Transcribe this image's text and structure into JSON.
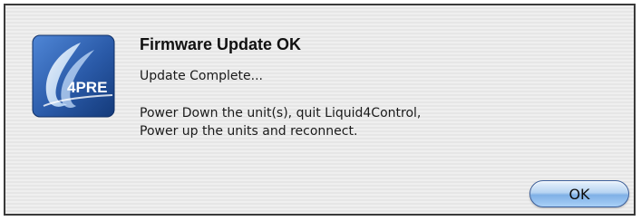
{
  "dialog": {
    "title": "Firmware Update OK",
    "subtitle": "Update Complete...",
    "message_lines": [
      "Power Down the unit(s), quit Liquid4Control,",
      "Power up the units and reconnect."
    ],
    "app_icon": {
      "name": "4pre-app-icon",
      "text": "4PRE"
    }
  },
  "buttons": {
    "ok_label": "OK"
  },
  "colors": {
    "icon_blue": "#2a5aa8",
    "button_blue": "#8fbdee"
  }
}
